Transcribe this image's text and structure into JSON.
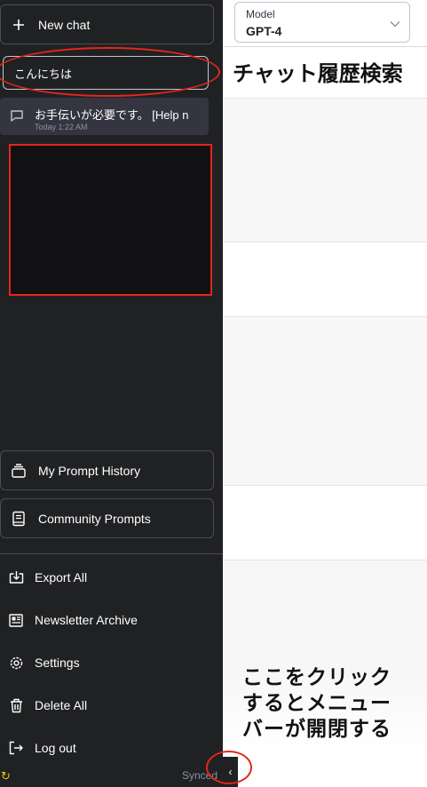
{
  "sidebar": {
    "new_chat_label": "New chat",
    "search": {
      "value": "こんにちは",
      "placeholder": ""
    },
    "conversations": [
      {
        "title": "お手伝いが必要です。 [Help n",
        "time": "Today 1:22 AM"
      }
    ],
    "prompt_history_label": "My Prompt History",
    "community_prompts_label": "Community Prompts",
    "menu": [
      {
        "label": "Export All",
        "icon": "export-icon"
      },
      {
        "label": "Newsletter Archive",
        "icon": "newsletter-icon"
      },
      {
        "label": "Settings",
        "icon": "gear-icon"
      },
      {
        "label": "Delete All",
        "icon": "trash-icon"
      },
      {
        "label": "Log out",
        "icon": "logout-icon"
      }
    ],
    "sync_status": "Synced",
    "toggle_glyph": "‹"
  },
  "main": {
    "model_label": "Model",
    "model_value": "GPT-4",
    "title": "チャット履歴検索"
  },
  "annotation": {
    "lines": [
      "ここをクリック",
      "するとメニュー",
      "バーが開閉する"
    ],
    "color": "#e3261c"
  },
  "colors": {
    "sidebar_bg": "#202123",
    "sync_icon": "#f2c200"
  }
}
